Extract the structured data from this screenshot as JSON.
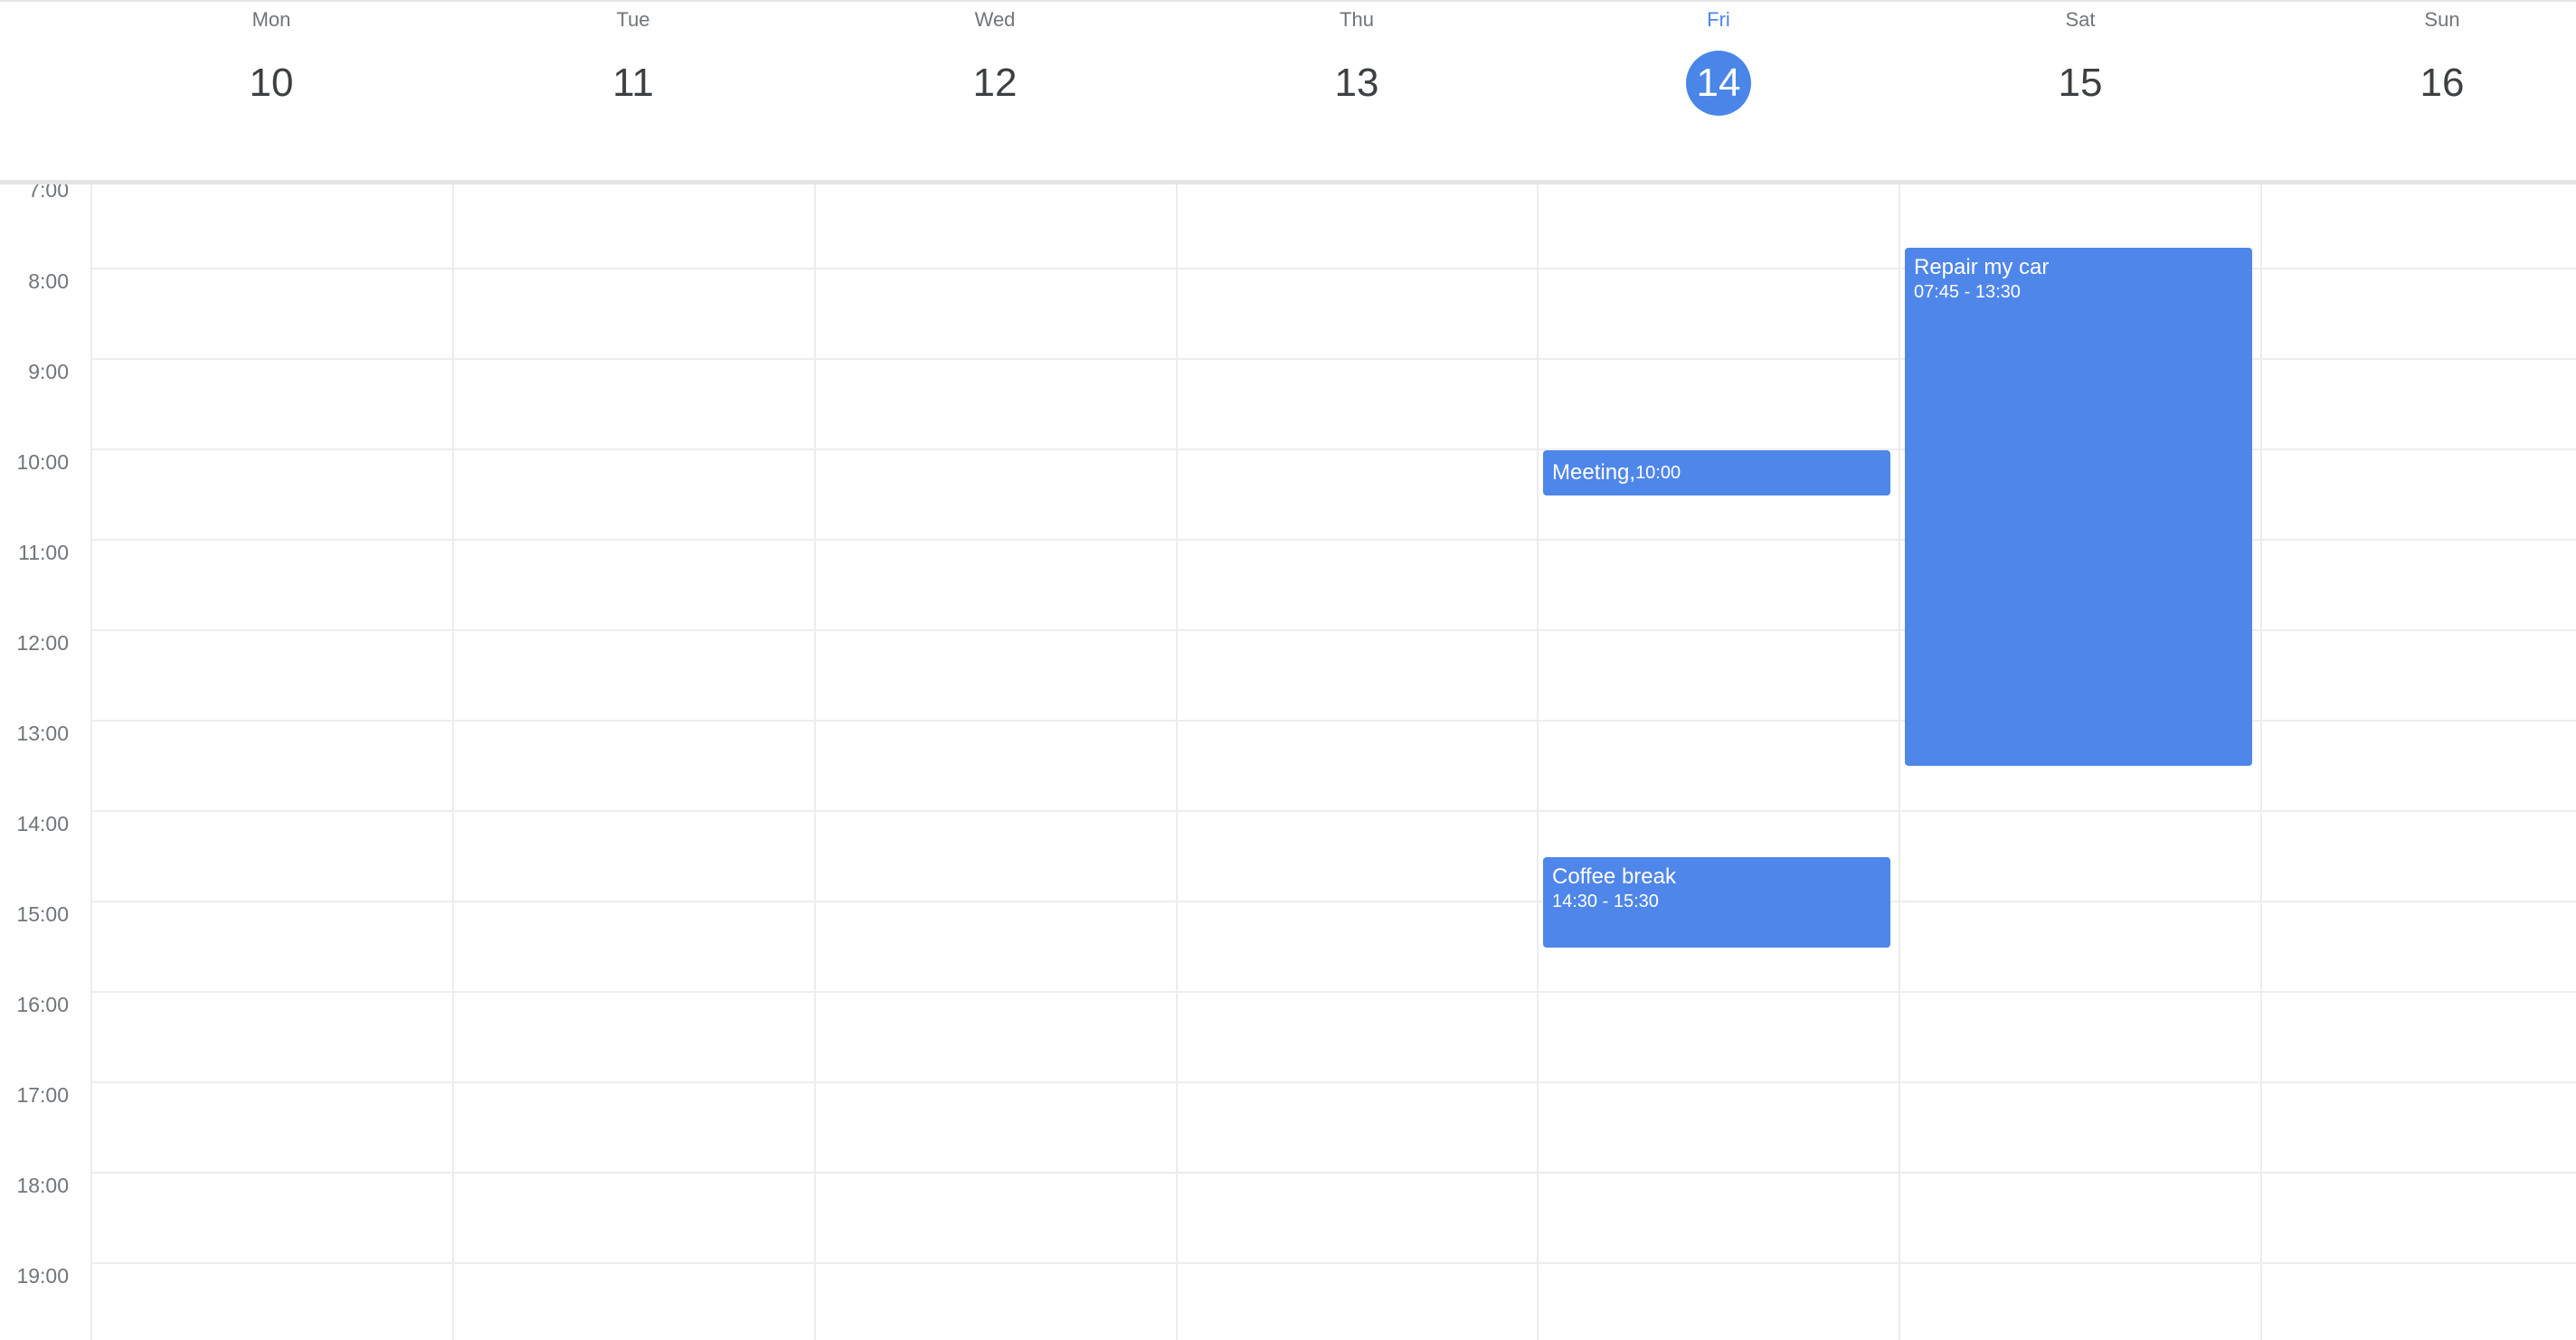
{
  "week": {
    "days": [
      {
        "name": "Mon",
        "date": "10"
      },
      {
        "name": "Tue",
        "date": "11"
      },
      {
        "name": "Wed",
        "date": "12"
      },
      {
        "name": "Thu",
        "date": "13"
      },
      {
        "name": "Fri",
        "date": "14",
        "today": true
      },
      {
        "name": "Sat",
        "date": "15"
      },
      {
        "name": "Sun",
        "date": "16"
      }
    ],
    "hours": [
      "7:00",
      "8:00",
      "9:00",
      "10:00",
      "11:00",
      "12:00",
      "13:00",
      "14:00",
      "15:00",
      "16:00",
      "17:00",
      "18:00",
      "19:00"
    ]
  },
  "events": {
    "meeting": {
      "title": "Meeting,",
      "time": "10:00",
      "day": "Fri",
      "start": "10:00"
    },
    "coffee": {
      "title": "Coffee break",
      "time": "14:30 - 15:30",
      "day": "Fri",
      "start": "14:30",
      "end": "15:30"
    },
    "repair": {
      "title": "Repair my car",
      "time": "07:45 - 13:30",
      "day": "Sat",
      "start": "07:45",
      "end": "13:30"
    }
  },
  "colors": {
    "accent": "#4a86e8",
    "event": "#4f86ea",
    "gridline": "#ededed",
    "muted_text": "#70757a"
  }
}
